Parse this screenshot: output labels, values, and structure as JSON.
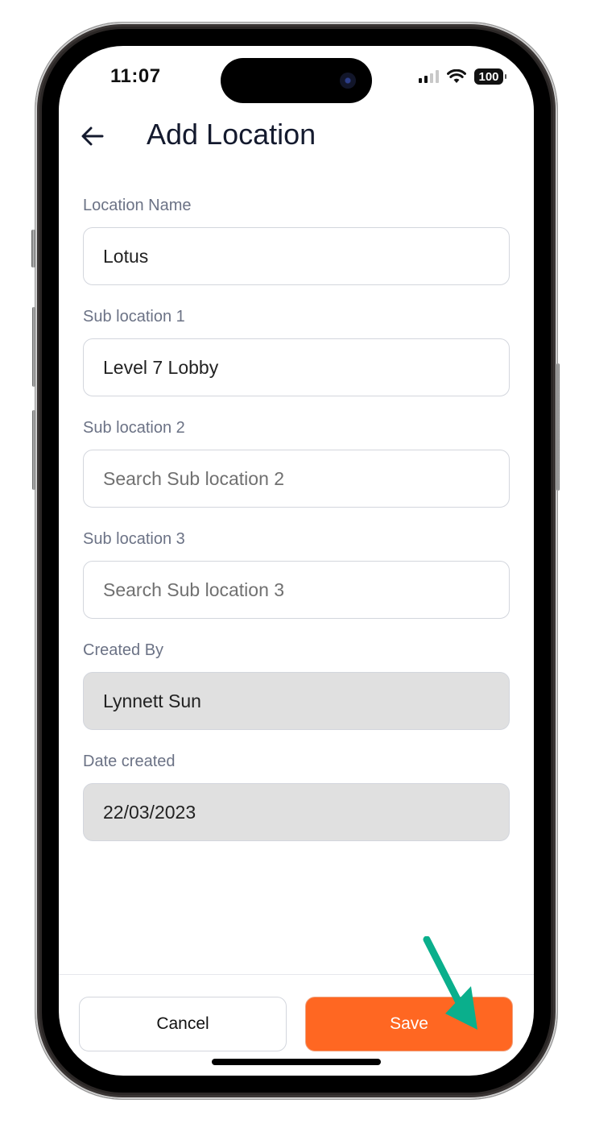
{
  "status_bar": {
    "time": "11:07",
    "battery": "100",
    "signal_icon": "cellular-signal-icon",
    "wifi_icon": "wifi-icon"
  },
  "header": {
    "back_icon": "arrow-left-icon",
    "title": "Add Location"
  },
  "form": {
    "fields": [
      {
        "label": "Location Name",
        "value": "Lotus",
        "placeholder": "",
        "readonly": false
      },
      {
        "label": "Sub location 1",
        "value": "Level 7 Lobby",
        "placeholder": "",
        "readonly": false
      },
      {
        "label": "Sub location 2",
        "value": "",
        "placeholder": "Search Sub location 2",
        "readonly": false
      },
      {
        "label": "Sub location 3",
        "value": "",
        "placeholder": "Search Sub location 3",
        "readonly": false
      },
      {
        "label": "Created By",
        "value": "Lynnett Sun",
        "placeholder": "",
        "readonly": true
      },
      {
        "label": "Date created",
        "value": "22/03/2023",
        "placeholder": "",
        "readonly": true
      }
    ]
  },
  "footer": {
    "cancel_label": "Cancel",
    "save_label": "Save"
  },
  "colors": {
    "accent": "#ff6722",
    "annotation_arrow": "#0aaf8c",
    "readonly_bg": "#e0e0e0",
    "label": "#6b7285",
    "title": "#141a2e"
  },
  "annotation": {
    "icon": "pointer-arrow-icon",
    "target": "save-button"
  }
}
